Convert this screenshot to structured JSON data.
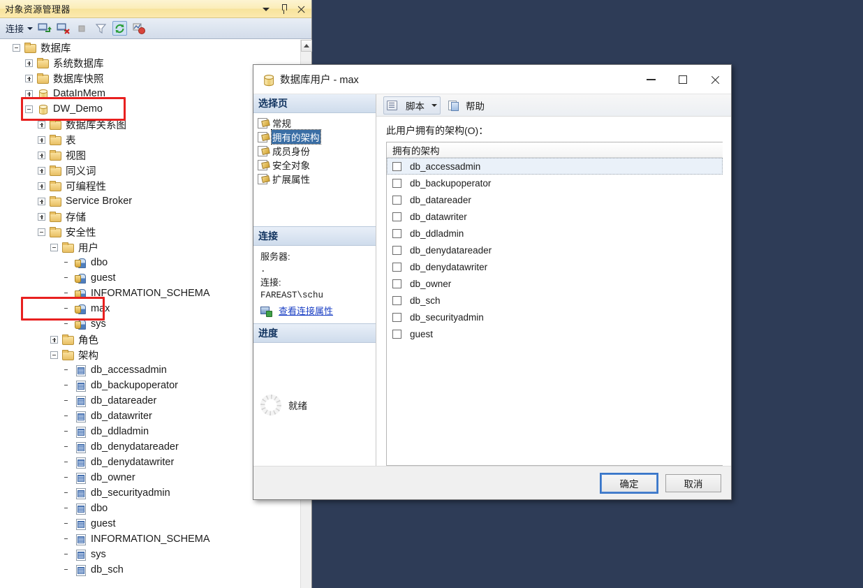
{
  "object_explorer": {
    "title": "对象资源管理器",
    "title_buttons": [
      {
        "name": "window-menu-dropdown-icon",
        "glyph": "caret-down"
      },
      {
        "name": "auto-hide-pin-icon",
        "glyph": "pin"
      },
      {
        "name": "close-icon",
        "glyph": "x"
      }
    ],
    "toolbar": {
      "connect_label": "连接",
      "icons": [
        "connect-object-explorer-icon",
        "disconnect-object-explorer-icon",
        "stop-icon",
        "filter-icon",
        "refresh-icon",
        "activity-monitor-icon"
      ]
    },
    "tree": [
      {
        "label": "数据库",
        "indent": 0,
        "expander": "minus",
        "icon": "folder"
      },
      {
        "label": "系统数据库",
        "indent": 1,
        "expander": "plus",
        "icon": "folder"
      },
      {
        "label": "数据库快照",
        "indent": 1,
        "expander": "plus",
        "icon": "folder"
      },
      {
        "label": "DataInMem",
        "indent": 1,
        "expander": "plus",
        "icon": "db"
      },
      {
        "label": "DW_Demo",
        "indent": 1,
        "expander": "minus",
        "icon": "db",
        "highlighted": true
      },
      {
        "label": "数据库关系图",
        "indent": 2,
        "expander": "plus",
        "icon": "folder"
      },
      {
        "label": "表",
        "indent": 2,
        "expander": "plus",
        "icon": "folder"
      },
      {
        "label": "视图",
        "indent": 2,
        "expander": "plus",
        "icon": "folder"
      },
      {
        "label": "同义词",
        "indent": 2,
        "expander": "plus",
        "icon": "folder"
      },
      {
        "label": "可编程性",
        "indent": 2,
        "expander": "plus",
        "icon": "folder"
      },
      {
        "label": "Service Broker",
        "indent": 2,
        "expander": "plus",
        "icon": "folder"
      },
      {
        "label": "存储",
        "indent": 2,
        "expander": "plus",
        "icon": "folder"
      },
      {
        "label": "安全性",
        "indent": 2,
        "expander": "minus",
        "icon": "folder"
      },
      {
        "label": "用户",
        "indent": 3,
        "expander": "minus",
        "icon": "folder"
      },
      {
        "label": "dbo",
        "indent": 4,
        "expander": "none",
        "icon": "user"
      },
      {
        "label": "guest",
        "indent": 4,
        "expander": "none",
        "icon": "user"
      },
      {
        "label": "INFORMATION_SCHEMA",
        "indent": 4,
        "expander": "none",
        "icon": "user"
      },
      {
        "label": "max",
        "indent": 4,
        "expander": "none",
        "icon": "user",
        "highlighted": true
      },
      {
        "label": "sys",
        "indent": 4,
        "expander": "none",
        "icon": "user"
      },
      {
        "label": "角色",
        "indent": 3,
        "expander": "plus",
        "icon": "folder"
      },
      {
        "label": "架构",
        "indent": 3,
        "expander": "minus",
        "icon": "folder"
      },
      {
        "label": "db_accessadmin",
        "indent": 4,
        "expander": "none",
        "icon": "schema"
      },
      {
        "label": "db_backupoperator",
        "indent": 4,
        "expander": "none",
        "icon": "schema"
      },
      {
        "label": "db_datareader",
        "indent": 4,
        "expander": "none",
        "icon": "schema"
      },
      {
        "label": "db_datawriter",
        "indent": 4,
        "expander": "none",
        "icon": "schema"
      },
      {
        "label": "db_ddladmin",
        "indent": 4,
        "expander": "none",
        "icon": "schema"
      },
      {
        "label": "db_denydatareader",
        "indent": 4,
        "expander": "none",
        "icon": "schema"
      },
      {
        "label": "db_denydatawriter",
        "indent": 4,
        "expander": "none",
        "icon": "schema"
      },
      {
        "label": "db_owner",
        "indent": 4,
        "expander": "none",
        "icon": "schema"
      },
      {
        "label": "db_securityadmin",
        "indent": 4,
        "expander": "none",
        "icon": "schema"
      },
      {
        "label": "dbo",
        "indent": 4,
        "expander": "none",
        "icon": "schema"
      },
      {
        "label": "guest",
        "indent": 4,
        "expander": "none",
        "icon": "schema"
      },
      {
        "label": "INFORMATION_SCHEMA",
        "indent": 4,
        "expander": "none",
        "icon": "schema"
      },
      {
        "label": "sys",
        "indent": 4,
        "expander": "none",
        "icon": "schema"
      },
      {
        "label": "db_sch",
        "indent": 4,
        "expander": "none",
        "icon": "schema"
      }
    ],
    "scrollbar_up_icon": "scroll-up-arrow-icon"
  },
  "dialog": {
    "title": "数据库用户 - max",
    "title_icon": "database-user-icon",
    "window_buttons": {
      "minimize": "minimize-icon",
      "maximize": "maximize-icon",
      "close": "close-icon"
    },
    "select_page": {
      "header": "选择页",
      "items": [
        {
          "label": "常规",
          "selected": false
        },
        {
          "label": "拥有的架构",
          "selected": true
        },
        {
          "label": "成员身份",
          "selected": false
        },
        {
          "label": "安全对象",
          "selected": false
        },
        {
          "label": "扩展属性",
          "selected": false
        }
      ]
    },
    "connection": {
      "header": "连接",
      "server_label": "服务器:",
      "server_value": ".",
      "connection_label": "连接:",
      "connection_value": "FAREAST\\schu",
      "view_properties_link": "查看连接属性"
    },
    "progress": {
      "header": "进度",
      "status": "就绪"
    },
    "toolbar": {
      "script_label": "脚本",
      "script_icon": "script-icon",
      "script_dropdown_icon": "chevron-down-icon",
      "help_label": "帮助",
      "help_icon": "help-icon"
    },
    "content": {
      "field_label": "此用户拥有的架构(O)：",
      "grid_header": "拥有的架构",
      "rows": [
        {
          "label": "db_accessadmin",
          "checked": false,
          "selected": true
        },
        {
          "label": "db_backupoperator",
          "checked": false,
          "selected": false
        },
        {
          "label": "db_datareader",
          "checked": false,
          "selected": false
        },
        {
          "label": "db_datawriter",
          "checked": false,
          "selected": false
        },
        {
          "label": "db_ddladmin",
          "checked": false,
          "selected": false
        },
        {
          "label": "db_denydatareader",
          "checked": false,
          "selected": false
        },
        {
          "label": "db_denydatawriter",
          "checked": false,
          "selected": false
        },
        {
          "label": "db_owner",
          "checked": false,
          "selected": false
        },
        {
          "label": "db_sch",
          "checked": false,
          "selected": false
        },
        {
          "label": "db_securityadmin",
          "checked": false,
          "selected": false
        },
        {
          "label": "guest",
          "checked": false,
          "selected": false
        }
      ]
    },
    "footer": {
      "ok_label": "确定",
      "cancel_label": "取消"
    }
  },
  "colors": {
    "desktop_background": "#2e3c57",
    "highlight_red": "#e8201f",
    "selection_blue": "#3a6ea5",
    "row_selected": "#eaf1f9",
    "link_blue": "#1a3fc4"
  }
}
